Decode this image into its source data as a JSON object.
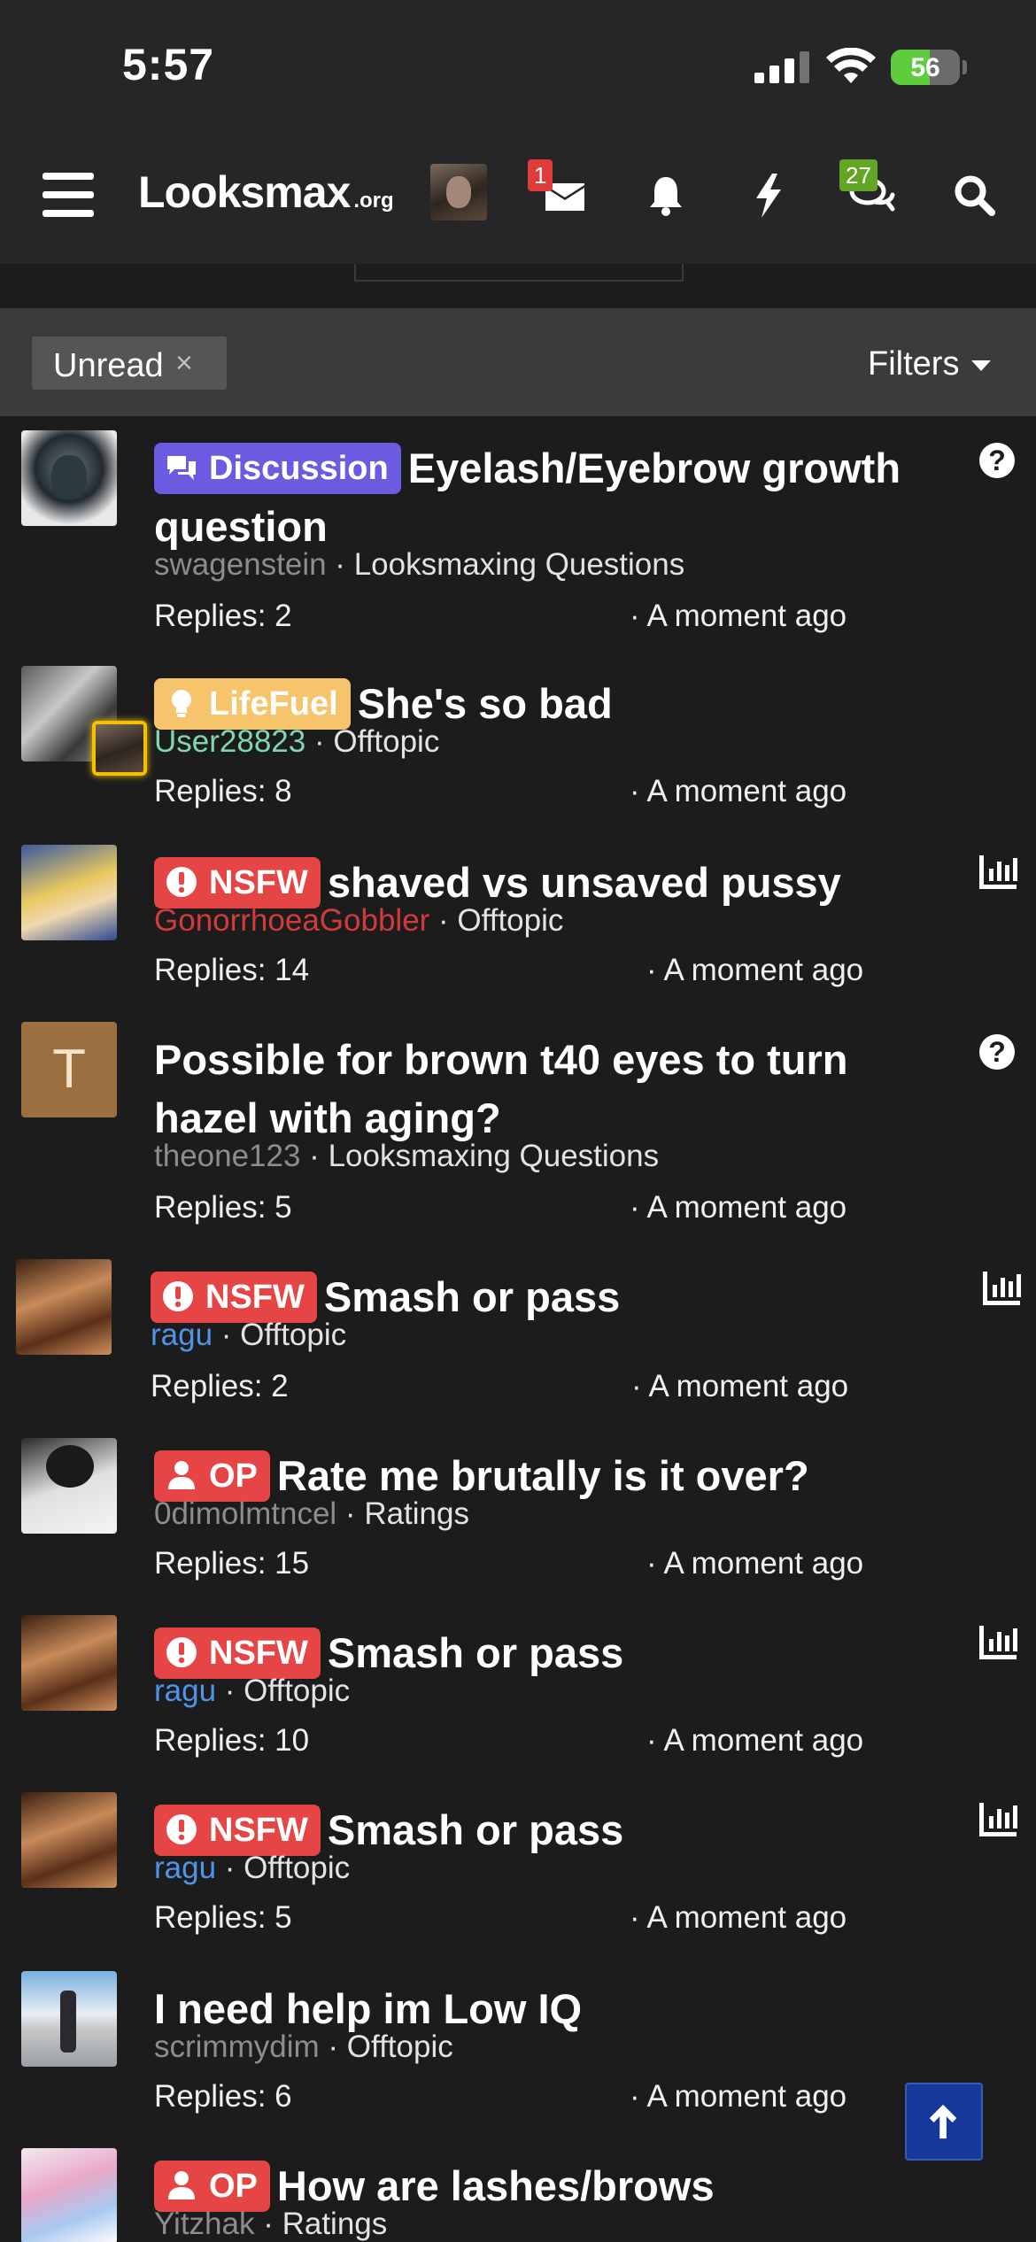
{
  "status_bar": {
    "time": "5:57",
    "battery": "56",
    "battery_level": 0.56,
    "battery_color": "#5fcc3d"
  },
  "header": {
    "logo_main": "Looksmax",
    "logo_suffix": ".org",
    "icons": [
      "menu-icon",
      "user-avatar",
      "envelope-icon",
      "bell-icon",
      "bolt-icon",
      "chat-bubbles-icon",
      "search-icon"
    ],
    "inbox_badge": "1",
    "inbox_badge_color": "#e03b3b",
    "alerts_badge": "27",
    "alerts_badge_color": "#63a524"
  },
  "filters": {
    "chip_label": "Unread",
    "chip_remove": "×",
    "filters_label": "Filters"
  },
  "colors": {
    "discussion": "#6a5ce0",
    "lifefuel": "#f5c46b",
    "nsfw": "#e64545",
    "op": "#e64545",
    "author_default": "#8d8d90",
    "author_green": "#7fd7b0",
    "author_red": "#d23b3b",
    "author_blue": "#4f94e8"
  },
  "threads": [
    {
      "prefix": "Discussion",
      "title": "Eyelash/Eyebrow growth question",
      "author": "swagenstein",
      "forum": "Looksmaxing Questions",
      "replies": "Replies: 2",
      "time": "· A moment ago",
      "status_icon": "question-icon"
    },
    {
      "prefix": "LifeFuel",
      "title": "She's so bad",
      "author": "User28823",
      "forum": "Offtopic",
      "replies": "Replies: 8",
      "time": "· A moment ago",
      "status_icon": ""
    },
    {
      "prefix": "NSFW",
      "title": "shaved vs unsaved pussy",
      "author": "GonorrhoeaGobbler",
      "forum": "Offtopic",
      "replies": "Replies: 14",
      "time": "· A moment ago",
      "status_icon": "poll-icon"
    },
    {
      "prefix": "",
      "title": "Possible for brown t40 eyes to turn hazel with aging?",
      "author": "theone123",
      "forum": "Looksmaxing Questions",
      "replies": "Replies: 5",
      "time": "· A moment ago",
      "status_icon": "question-icon",
      "avatar_letter": "T",
      "avatar_color": "#9a7040"
    },
    {
      "prefix": "NSFW",
      "title": "Smash or pass",
      "author": "ragu",
      "forum": "Offtopic",
      "replies": "Replies: 2",
      "time": "· A moment ago",
      "status_icon": "poll-icon"
    },
    {
      "prefix": "OP",
      "title": "Rate me brutally is it over?",
      "author": "0dimolmtncel",
      "forum": "Ratings",
      "replies": "Replies: 15",
      "time": "· A moment ago",
      "status_icon": ""
    },
    {
      "prefix": "NSFW",
      "title": "Smash or pass",
      "author": "ragu",
      "forum": "Offtopic",
      "replies": "Replies: 10",
      "time": "· A moment ago",
      "status_icon": "poll-icon"
    },
    {
      "prefix": "NSFW",
      "title": "Smash or pass",
      "author": "ragu",
      "forum": "Offtopic",
      "replies": "Replies: 5",
      "time": "· A moment ago",
      "status_icon": "poll-icon"
    },
    {
      "prefix": "",
      "title": "I need help im Low IQ",
      "author": "scrimmydim",
      "forum": "Offtopic",
      "replies": "Replies: 6",
      "time": "· A moment ago",
      "status_icon": ""
    },
    {
      "prefix": "OP",
      "title": "How are lashes/brows",
      "author": "Yitzhak",
      "forum": "Ratings",
      "replies": "",
      "time": "",
      "status_icon": ""
    }
  ],
  "scroll_top": {
    "icon": "arrow-up-icon"
  }
}
